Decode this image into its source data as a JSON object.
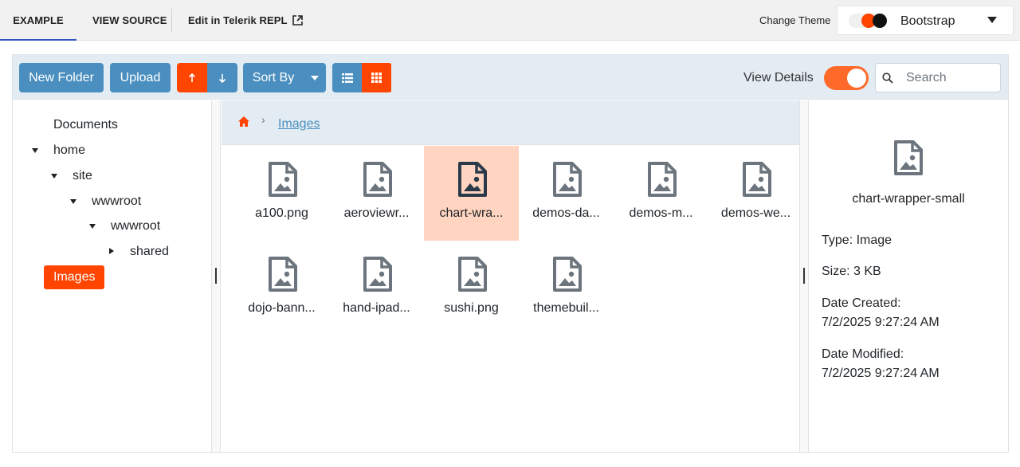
{
  "topbar": {
    "tab_example": "EXAMPLE",
    "tab_view_source": "VIEW SOURCE",
    "tab_repl": "Edit in Telerik REPL",
    "change_theme_label": "Change Theme",
    "theme_value": "Bootstrap",
    "accent": "#3354c4"
  },
  "toolbar": {
    "new_folder": "New Folder",
    "upload": "Upload",
    "sort_by": "Sort By",
    "view_details_label": "View Details",
    "view_details_on": true,
    "search_placeholder": "Search"
  },
  "tree": {
    "items": [
      "Documents",
      "home",
      "site",
      "wwwroot",
      "wwwroot",
      "shared",
      "Images"
    ],
    "selected": "Images"
  },
  "breadcrumb": {
    "current": "Images"
  },
  "files": [
    {
      "name": "a100.png"
    },
    {
      "name": "aeroviewr..."
    },
    {
      "name": "chart-wra..."
    },
    {
      "name": "demos-da..."
    },
    {
      "name": "demos-m..."
    },
    {
      "name": "demos-we..."
    },
    {
      "name": "dojo-bann..."
    },
    {
      "name": "hand-ipad..."
    },
    {
      "name": "sushi.png"
    },
    {
      "name": "themebuil..."
    }
  ],
  "details": {
    "name": "chart-wrapper-small",
    "type": "Type: Image",
    "size": "Size: 3 KB",
    "created_label": "Date Created:",
    "created": "7/2/2025 9:27:24 AM",
    "modified_label": "Date Modified:",
    "modified": "7/2/2025 9:27:24 AM"
  },
  "colors": {
    "primary": "#4a8fbf",
    "accent_orange": "#ff4500",
    "selected_bg": "#ffd4c0",
    "panel_bg": "#e3ecf3"
  },
  "icons": [
    "external-link-icon",
    "arrow-up-icon",
    "arrow-down-icon",
    "chevron-down-icon",
    "list-view-icon",
    "grid-view-icon",
    "search-icon",
    "home-icon",
    "chevron-right-icon",
    "image-file-icon"
  ]
}
